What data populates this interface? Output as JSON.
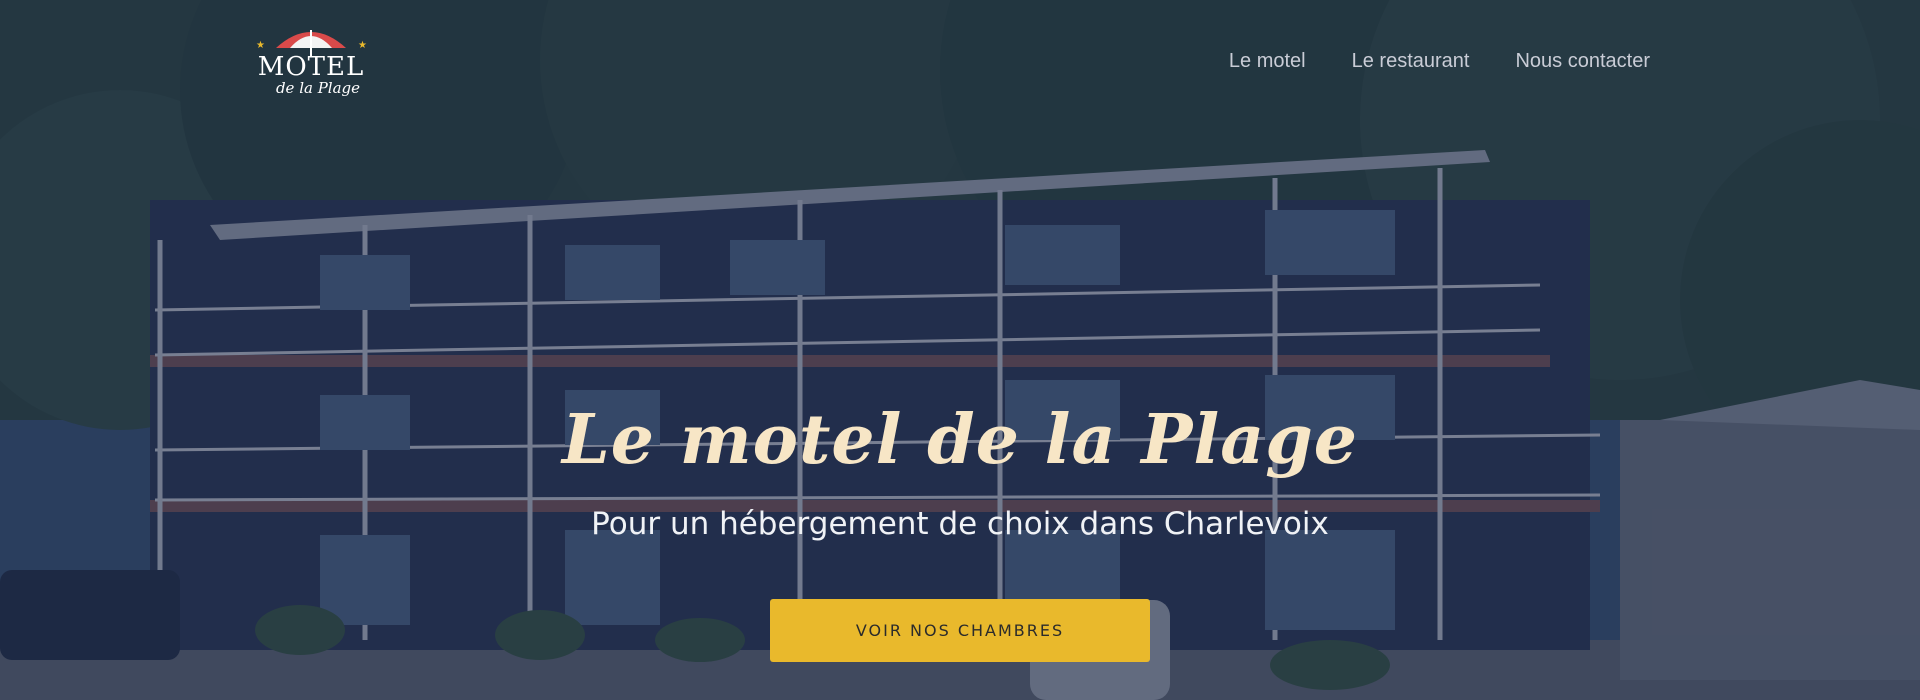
{
  "header": {
    "logo": {
      "word": "MOTEL",
      "subword": "de la Plage"
    },
    "nav": [
      {
        "label": "Le motel"
      },
      {
        "label": "Le restaurant"
      },
      {
        "label": "Nous contacter"
      }
    ]
  },
  "hero": {
    "title": "Le motel de la Plage",
    "subtitle": "Pour un hébergement de choix dans Charlevoix",
    "cta_label": "VOIR NOS CHAMBRES"
  },
  "colors": {
    "overlay": "#1c2848",
    "title": "#f7e6c6",
    "cta_background": "#e9b92c",
    "nav_text": "#c9ccd6",
    "logo_umbrella": "#d94a4a"
  },
  "icons": [
    "umbrella-logo-icon",
    "star-icon"
  ]
}
